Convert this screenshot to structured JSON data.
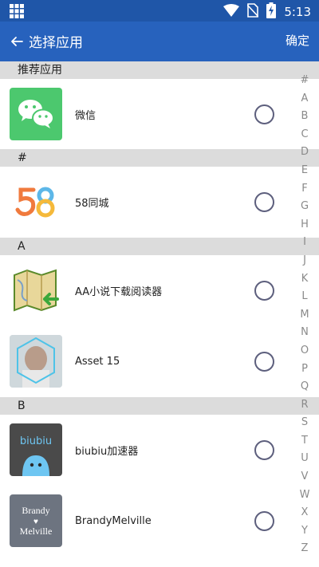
{
  "status_bar": {
    "time": "5:13",
    "icons": [
      "grid-icon",
      "wifi-icon",
      "no-sim-icon",
      "battery-charging-icon"
    ]
  },
  "app_bar": {
    "title": "选择应用",
    "confirm_label": "确定",
    "back_icon": "arrow-left-icon"
  },
  "sections": [
    {
      "header": "推荐应用",
      "apps": [
        {
          "name": "微信",
          "icon": "wechat-icon"
        }
      ]
    },
    {
      "header": "#",
      "apps": [
        {
          "name": "58同城",
          "icon": "58tongcheng-icon"
        }
      ]
    },
    {
      "header": "A",
      "apps": [
        {
          "name": "AA小说下载阅读器",
          "icon": "map-book-icon"
        },
        {
          "name": "Asset 15",
          "icon": "asset15-icon"
        }
      ]
    },
    {
      "header": "B",
      "apps": [
        {
          "name": "biubiu加速器",
          "icon": "biubiu-icon",
          "icon_text": "biubiu"
        },
        {
          "name": "BrandyMelville",
          "icon": "brandy-icon",
          "icon_text_1": "Brandy",
          "icon_text_2": "♥",
          "icon_text_3": "Melville"
        }
      ]
    }
  ],
  "index_letters": [
    "#",
    "A",
    "B",
    "C",
    "D",
    "E",
    "F",
    "G",
    "H",
    "I",
    "J",
    "K",
    "L",
    "M",
    "N",
    "O",
    "P",
    "Q",
    "R",
    "S",
    "T",
    "U",
    "V",
    "W",
    "X",
    "Y",
    "Z"
  ],
  "colors": {
    "status_bar": "#1f56a8",
    "app_bar": "#2762bd",
    "section_header": "#dcdcdc",
    "radio_border": "#5d5f7d"
  }
}
